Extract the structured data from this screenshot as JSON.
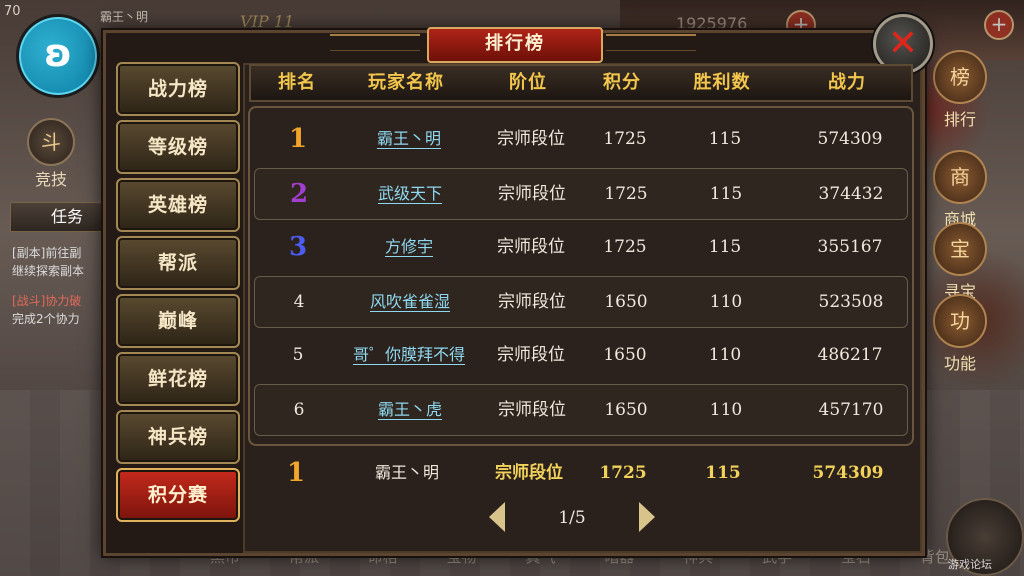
{
  "background": {
    "level": "70",
    "player_name": "霸王丶明",
    "vip": "VIP 11",
    "gold": "1925976",
    "plus": "+",
    "left_buttons": [
      {
        "label": "竞技",
        "icon_text": "斗"
      }
    ],
    "task_tab": "任务",
    "task_lines": [
      "[副本]前往副",
      "继续探索副本",
      "[战斗]协力破",
      "完成2个协力"
    ],
    "right_buttons": [
      {
        "label": "排行",
        "icon_text": "榜"
      },
      {
        "label": "商城",
        "icon_text": "商"
      },
      {
        "label": "寻宝",
        "icon_text": "宝"
      },
      {
        "label": "功能",
        "icon_text": "功"
      }
    ],
    "bottom_menu": [
      "黑市",
      "帮派",
      "命格",
      "宝物",
      "真气",
      "暗器",
      "神兵",
      "武学",
      "宝石",
      "背包"
    ],
    "watermark": "游戏论坛"
  },
  "dialog": {
    "title": "排行榜",
    "close_glyph": "✕"
  },
  "tabs": [
    {
      "label": "战力榜",
      "active": false
    },
    {
      "label": "等级榜",
      "active": false
    },
    {
      "label": "英雄榜",
      "active": false
    },
    {
      "label": "帮派",
      "active": false
    },
    {
      "label": "巅峰",
      "active": false
    },
    {
      "label": "鲜花榜",
      "active": false
    },
    {
      "label": "神兵榜",
      "active": false
    },
    {
      "label": "积分赛",
      "active": true
    }
  ],
  "table": {
    "headers": [
      "排名",
      "玩家名称",
      "阶位",
      "积分",
      "胜利数",
      "战力"
    ],
    "rows": [
      {
        "rank": "1",
        "name": "霸王丶明",
        "tier": "宗师段位",
        "score": "1725",
        "wins": "115",
        "power": "574309",
        "rank_color": "#f2a52a"
      },
      {
        "rank": "2",
        "name": "武级天下",
        "tier": "宗师段位",
        "score": "1725",
        "wins": "115",
        "power": "374432",
        "rank_color": "#a33fd0"
      },
      {
        "rank": "3",
        "name": "方修宇",
        "tier": "宗师段位",
        "score": "1725",
        "wins": "115",
        "power": "355167",
        "rank_color": "#4b5cf0"
      },
      {
        "rank": "4",
        "name": "风吹雀雀湿",
        "tier": "宗师段位",
        "score": "1650",
        "wins": "110",
        "power": "523508",
        "rank_color": "#f0e8dc"
      },
      {
        "rank": "5",
        "name": "哥゜你膜拜不得",
        "tier": "宗师段位",
        "score": "1650",
        "wins": "110",
        "power": "486217",
        "rank_color": "#f0e8dc"
      },
      {
        "rank": "6",
        "name": "霸王丶虎",
        "tier": "宗师段位",
        "score": "1650",
        "wins": "110",
        "power": "457170",
        "rank_color": "#f0e8dc"
      }
    ],
    "me": {
      "rank": "1",
      "name": "霸王丶明",
      "tier": "宗师段位",
      "score": "1725",
      "wins": "115",
      "power": "574309"
    }
  },
  "pager": {
    "label": "1/5"
  }
}
